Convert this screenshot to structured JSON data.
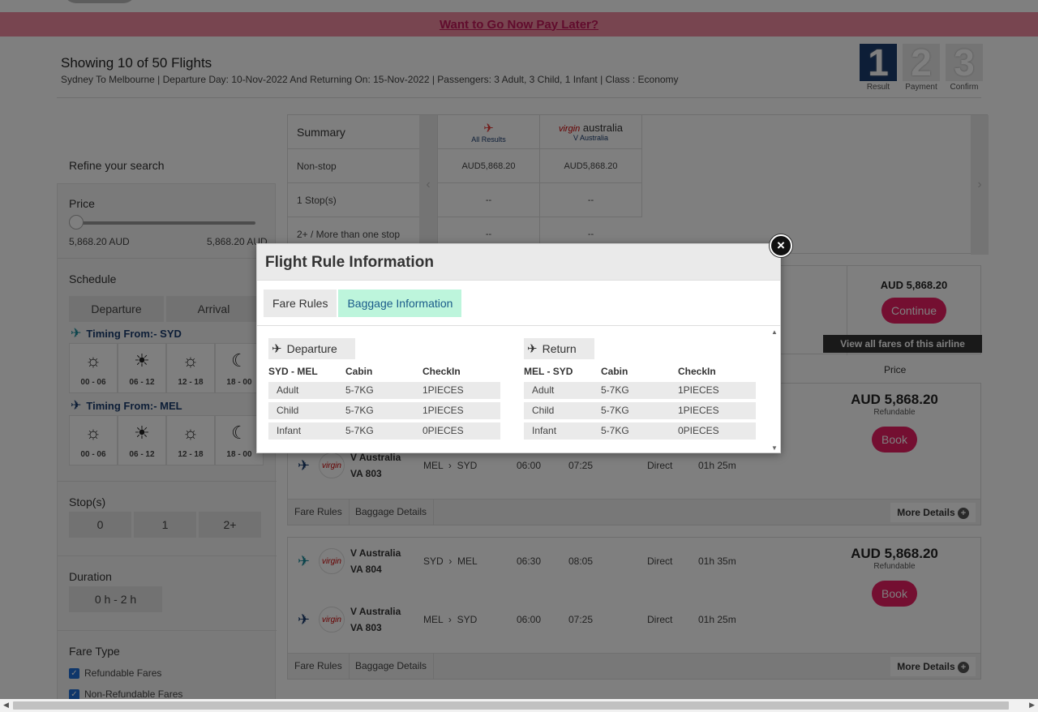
{
  "promo": {
    "text": "Want to Go Now Pay Later?"
  },
  "header": {
    "title": "Showing 10 of 50 Flights",
    "subtitle": "Sydney To Melbourne | Departure Day: 10-Nov-2022 And Returning On: 15-Nov-2022 | Passengers: 3 Adult, 3 Child, 1 Infant | Class : Economy"
  },
  "steps": [
    {
      "num": "1",
      "label": "Result"
    },
    {
      "num": "2",
      "label": "Payment"
    },
    {
      "num": "3",
      "label": "Confirm"
    }
  ],
  "sidebar": {
    "refine": "Refine your search",
    "price_title": "Price",
    "price_min": "5,868.20 AUD",
    "price_max": "5,868.20 AUD",
    "schedule_title": "Schedule",
    "tab_departure": "Departure",
    "tab_arrival": "Arrival",
    "timing_syd": "Timing From:- SYD",
    "timing_mel": "Timing From:- MEL",
    "slots": [
      "00 - 06",
      "06 - 12",
      "12 - 18",
      "18 - 00"
    ],
    "stops_title": "Stop(s)",
    "stops": [
      "0",
      "1",
      "2+"
    ],
    "duration_title": "Duration",
    "duration_value": "0 h - 2 h",
    "fare_type_title": "Fare Type",
    "fare_refundable": "Refundable Fares",
    "fare_nonrefundable": "Non-Refundable Fares"
  },
  "summary": {
    "rows": [
      "Summary",
      "Non-stop",
      "1 Stop(s)",
      "2+ / More than one stop"
    ],
    "airlines": [
      {
        "name": "All Results",
        "values": [
          "AUD5,868.20",
          "--",
          "--"
        ]
      },
      {
        "name": "V Australia",
        "logo": "australia",
        "values": [
          "AUD5,868.20",
          "--",
          "--"
        ]
      }
    ]
  },
  "card1": {
    "price": "AUD 5,868.20",
    "continue": "Continue",
    "view_all": "View all fares of this airline"
  },
  "col_price_label": "Price",
  "flights": [
    {
      "return_leg": {
        "airline": "V Australia",
        "code": "VA 803",
        "from": "MEL",
        "to": "SYD",
        "dep": "06:00",
        "arr": "07:25",
        "stops": "Direct",
        "duration": "01h 25m"
      },
      "fare_rules": "Fare Rules",
      "baggage": "Baggage Details",
      "more": "More Details"
    },
    {
      "out_leg": {
        "airline": "V Australia",
        "code": "VA 804",
        "from": "SYD",
        "to": "MEL",
        "dep": "06:30",
        "arr": "08:05",
        "stops": "Direct",
        "duration": "01h 35m"
      },
      "return_leg": {
        "airline": "V Australia",
        "code": "VA 803",
        "from": "MEL",
        "to": "SYD",
        "dep": "06:00",
        "arr": "07:25",
        "stops": "Direct",
        "duration": "01h 25m"
      },
      "price": "AUD 5,868.20",
      "refundable": "Refundable",
      "book": "Book",
      "fare_rules": "Fare Rules",
      "baggage": "Baggage Details",
      "more": "More Details"
    }
  ],
  "flight0_price": {
    "price": "AUD 5,868.20",
    "refundable": "Refundable",
    "book": "Book"
  },
  "modal": {
    "title": "Flight Rule Information",
    "tab_fare": "Fare Rules",
    "tab_baggage": "Baggage Information",
    "departure": {
      "label": "Departure",
      "route": "SYD - MEL",
      "col_cabin": "Cabin",
      "col_checkin": "CheckIn",
      "rows": [
        {
          "pax": "Adult",
          "cabin": "5-7KG",
          "checkin": "1PIECES"
        },
        {
          "pax": "Child",
          "cabin": "5-7KG",
          "checkin": "1PIECES"
        },
        {
          "pax": "Infant",
          "cabin": "5-7KG",
          "checkin": "0PIECES"
        }
      ]
    },
    "return": {
      "label": "Return",
      "route": "MEL - SYD",
      "col_cabin": "Cabin",
      "col_checkin": "CheckIn",
      "rows": [
        {
          "pax": "Adult",
          "cabin": "5-7KG",
          "checkin": "1PIECES"
        },
        {
          "pax": "Child",
          "cabin": "5-7KG",
          "checkin": "1PIECES"
        },
        {
          "pax": "Infant",
          "cabin": "5-7KG",
          "checkin": "0PIECES"
        }
      ]
    }
  },
  "colors": {
    "accent_pink": "#e91e63",
    "navy": "#1a3c6e",
    "tab_active": "#bdf5dc"
  }
}
